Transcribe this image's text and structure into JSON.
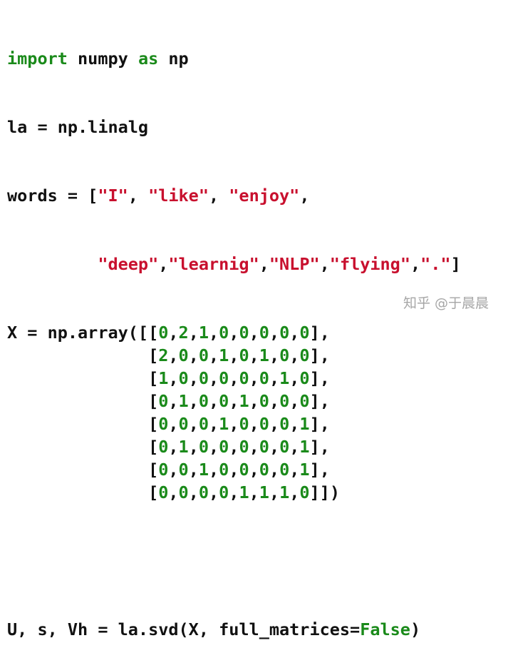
{
  "code": {
    "line1": {
      "kw1": "import",
      "mid": " numpy ",
      "kw2": "as",
      "end": " np"
    },
    "line2": "la = np.linalg",
    "line3": {
      "pre": "words = [",
      "s1": "\"I\"",
      "sep1": ", ",
      "s2": "\"like\"",
      "sep2": ", ",
      "s3": "\"enjoy\"",
      "end": ","
    },
    "line4": {
      "pre": "         ",
      "s1": "\"deep\"",
      "sep1": ",",
      "s2": "\"learnig\"",
      "sep2": ",",
      "s3": "\"NLP\"",
      "sep3": ",",
      "s4": "\"flying\"",
      "sep4": ",",
      "s5": "\".\"",
      "end": "]"
    },
    "matrix_prefix": "X = np.array([",
    "matrix_indent": "              ",
    "matrix": [
      [
        "0",
        "2",
        "1",
        "0",
        "0",
        "0",
        "0",
        "0"
      ],
      [
        "2",
        "0",
        "0",
        "1",
        "0",
        "1",
        "0",
        "0"
      ],
      [
        "1",
        "0",
        "0",
        "0",
        "0",
        "0",
        "1",
        "0"
      ],
      [
        "0",
        "1",
        "0",
        "0",
        "1",
        "0",
        "0",
        "0"
      ],
      [
        "0",
        "0",
        "0",
        "1",
        "0",
        "0",
        "0",
        "1"
      ],
      [
        "0",
        "1",
        "0",
        "0",
        "0",
        "0",
        "0",
        "1"
      ],
      [
        "0",
        "0",
        "1",
        "0",
        "0",
        "0",
        "0",
        "1"
      ],
      [
        "0",
        "0",
        "0",
        "0",
        "1",
        "1",
        "1",
        "0"
      ]
    ],
    "last_line": {
      "pre": "U, s, Vh = la.svd(X, full_matrices=",
      "kw": "False",
      "end": ")"
    }
  },
  "watermark": "知乎 @于晨晨",
  "colors": {
    "keyword": "#1a8a1a",
    "string": "#c8102e",
    "number": "#1a8a1a",
    "text": "#111111"
  }
}
